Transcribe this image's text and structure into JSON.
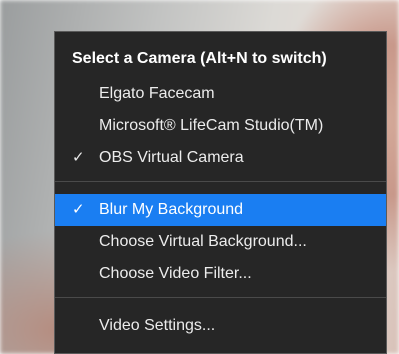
{
  "menu": {
    "header": "Select a Camera (Alt+N to switch)",
    "cameras": [
      {
        "label": "Elgato Facecam",
        "checked": false
      },
      {
        "label": "Microsoft® LifeCam Studio(TM)",
        "checked": false
      },
      {
        "label": "OBS Virtual Camera",
        "checked": true
      }
    ],
    "background_options": [
      {
        "label": "Blur My Background",
        "checked": true,
        "highlighted": true
      },
      {
        "label": "Choose Virtual Background...",
        "checked": false
      },
      {
        "label": "Choose Video Filter...",
        "checked": false
      }
    ],
    "settings": {
      "label": "Video Settings..."
    },
    "check_glyph": "✓",
    "icon": "checkmark-icon"
  },
  "colors": {
    "menu_background": "#262626",
    "highlight": "#1a7ef2",
    "separator": "#4a4a4a",
    "text": "#ececec"
  }
}
